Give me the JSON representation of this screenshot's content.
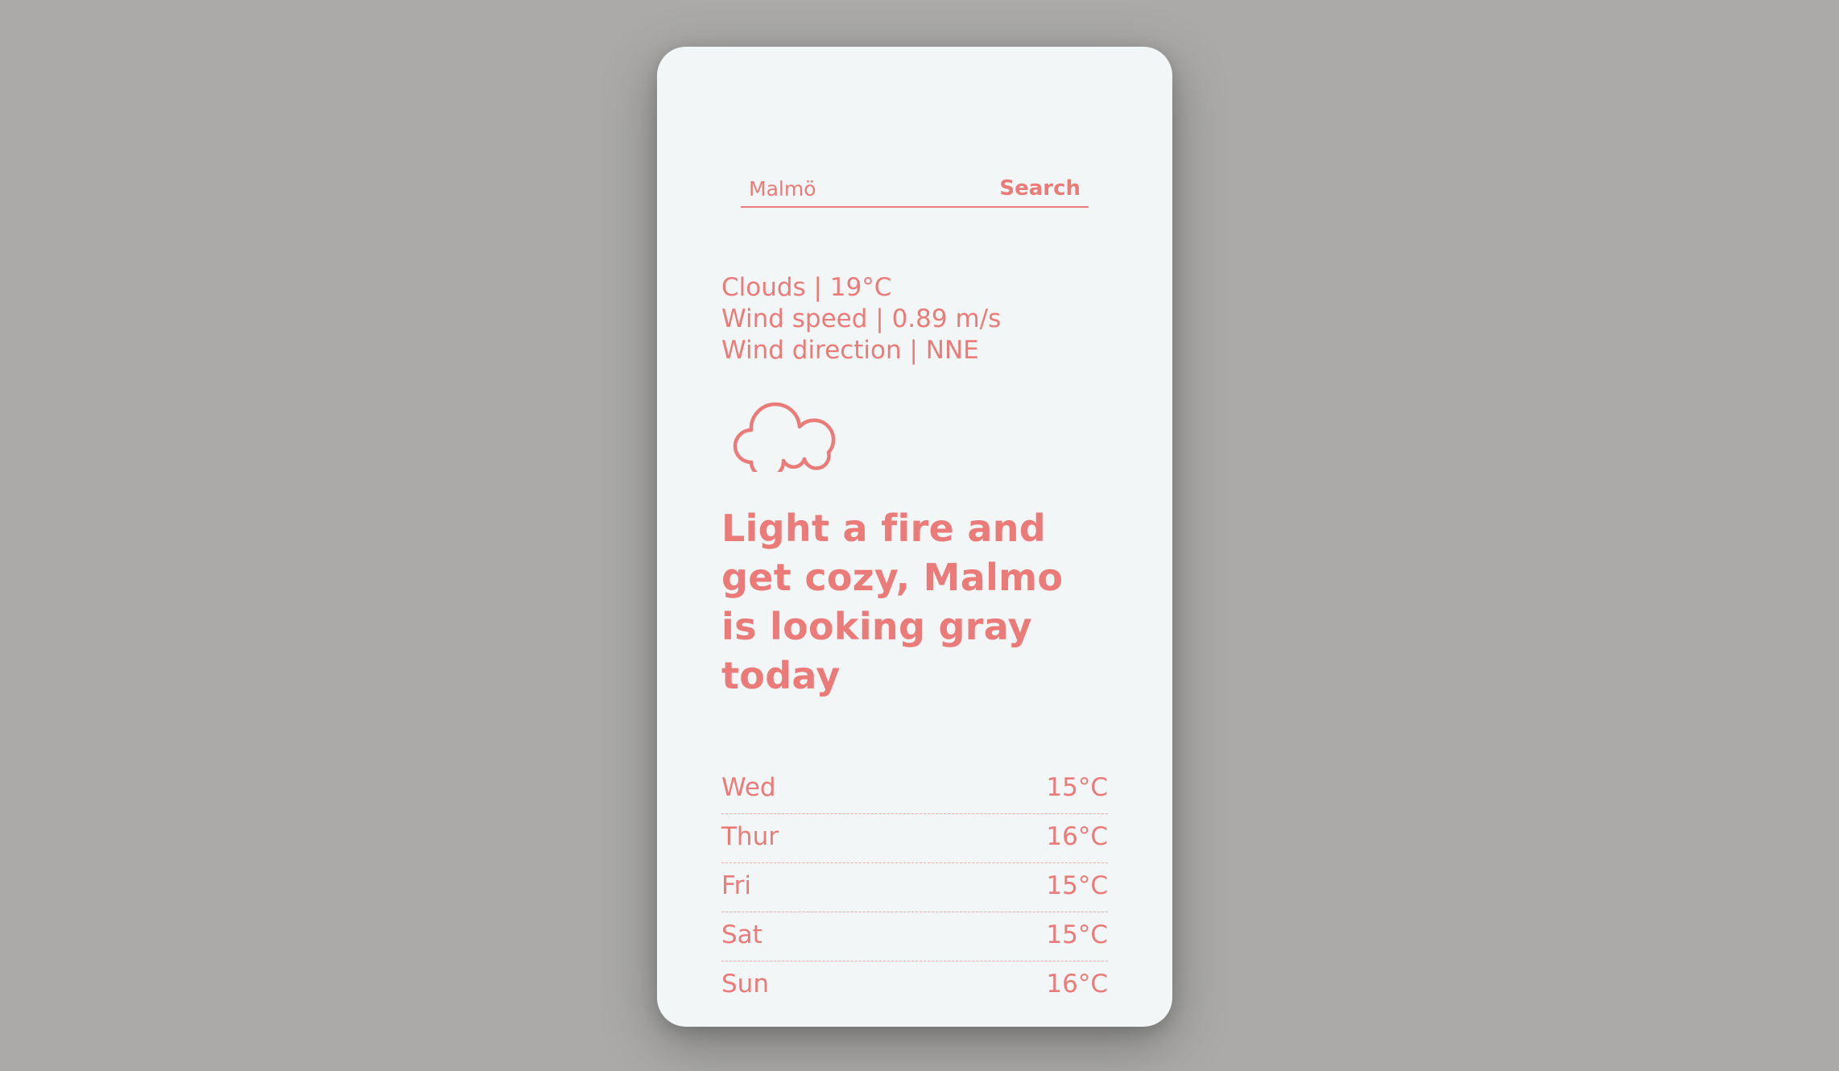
{
  "search": {
    "value": "Malmö",
    "button_label": "Search"
  },
  "current": {
    "condition": "Clouds | 19°C",
    "wind_speed": "Wind speed | 0.89 m/s",
    "wind_direction": "Wind direction | NNE",
    "icon": "cloud-icon"
  },
  "headline": "Light a fire and get cozy, Malmo is looking gray today",
  "forecast": [
    {
      "day": "Wed",
      "temp": "15°C"
    },
    {
      "day": "Thur",
      "temp": "16°C"
    },
    {
      "day": "Fri",
      "temp": "15°C"
    },
    {
      "day": "Sat",
      "temp": "15°C"
    },
    {
      "day": "Sun",
      "temp": "16°C"
    }
  ],
  "colors": {
    "background": "#abaaa9",
    "card": "#f3f6f7",
    "accent": "#ea7b78"
  }
}
